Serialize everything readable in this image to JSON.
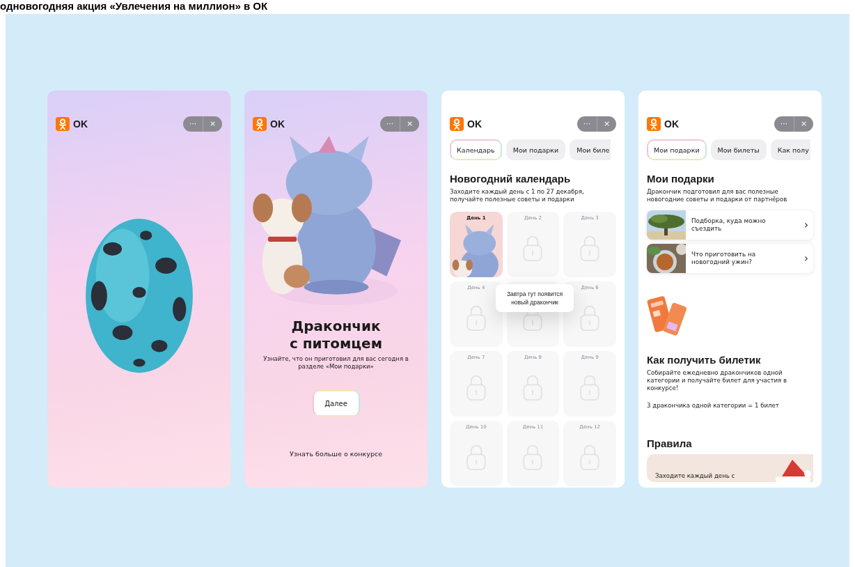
{
  "heading": "одновогодняя акция «Увлечения на миллион» в ОК",
  "screens": [
    {
      "kind": "egg",
      "logo": "OK",
      "menu_button": "···",
      "close_button": "×"
    },
    {
      "kind": "reveal",
      "logo": "OK",
      "menu_button": "···",
      "close_button": "×",
      "title_lines": [
        "Дракончик",
        "с питомцем"
      ],
      "description": "Узнайте, что он приготовил для вас сегодня в разделе «Мои подарки»",
      "button": "Далее",
      "link": "Узнать больше о конкурсе"
    },
    {
      "kind": "calendar",
      "logo": "OK",
      "menu_button": "···",
      "close_button": "×",
      "tabs": [
        {
          "label": "Календарь",
          "selected": true
        },
        {
          "label": "Мои подарки",
          "selected": false
        },
        {
          "label": "Мои биле",
          "selected": false
        }
      ],
      "title": "Новогодний календарь",
      "description": "Заходите каждый день с 1 по 27 декабря, получайте полезные советы и подарки",
      "days": [
        {
          "label": "День 1",
          "kind": "picture"
        },
        {
          "label": "День 2",
          "kind": "locked"
        },
        {
          "label": "День 3",
          "kind": "locked"
        },
        {
          "label": "День 4",
          "kind": "locked"
        },
        {
          "kind": "locked"
        },
        {
          "label": "День 6",
          "kind": "locked"
        },
        {
          "label": "День 7",
          "kind": "locked"
        },
        {
          "label": "День 8",
          "kind": "locked"
        },
        {
          "label": "День 9",
          "kind": "locked"
        },
        {
          "label": "День 10",
          "kind": "locked"
        },
        {
          "label": "День 11",
          "kind": "locked"
        },
        {
          "label": "День 12",
          "kind": "locked"
        }
      ],
      "tooltip": "Завтра тут появится новый дракончик"
    },
    {
      "kind": "gifts",
      "logo": "OK",
      "menu_button": "···",
      "close_button": "×",
      "tabs": [
        {
          "label": "Мои подарки",
          "selected": true
        },
        {
          "label": "Мои билеты",
          "selected": false
        },
        {
          "label": "Как полу",
          "selected": false
        }
      ],
      "title": "Мои подарки",
      "description": "Дракончик подготовил для вас полезные новогодние советы и подарки от партнёров",
      "offers": [
        {
          "text": "Подборка, куда можно съездить",
          "chevron": "›"
        },
        {
          "text": "Что приготовить на новогодний ужин?",
          "chevron": "›"
        }
      ],
      "ticket_title": "Как получить билетик",
      "ticket_text": "Собирайте ежедневно дракончиков одной категории и получайте билет для участия в конкурсе!",
      "ticket_note": "3 дракончика одной категории = 1 билет",
      "rules_title": "Правила",
      "rules_text": "Заходите каждый день с"
    }
  ]
}
